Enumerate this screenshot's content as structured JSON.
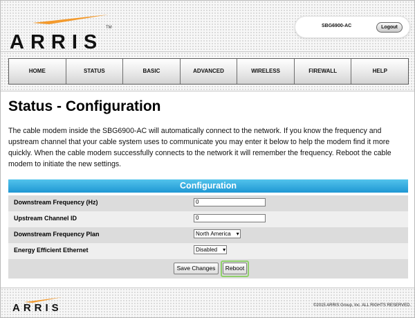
{
  "brand": {
    "logo_text": "ARRIS",
    "trademark": "TM",
    "swoosh_colors": [
      "#1b2d6b",
      "#f39a2d"
    ]
  },
  "header": {
    "model": "SBG6900-AC",
    "logout_label": "Logout"
  },
  "nav": {
    "tabs": [
      "HOME",
      "STATUS",
      "BASIC",
      "ADVANCED",
      "WIRELESS",
      "FIREWALL",
      "HELP"
    ]
  },
  "page": {
    "title": "Status - Configuration",
    "description": "The cable modem inside the SBG6900-AC will automatically connect to the network. If you know the frequency and upstream channel that your cable system uses to communicate you may enter it below to help the modem find it more quickly. When the cable modem successfully connects to the network it will remember the frequency. Reboot the cable modem to initiate the new settings."
  },
  "config": {
    "header": "Configuration",
    "header_color": "#2aa5dc",
    "rows": [
      {
        "label": "Downstream Frequency (Hz)",
        "value": "0"
      },
      {
        "label": "Upstream Channel ID",
        "value": "0"
      },
      {
        "label": "Downstream Frequency Plan",
        "value": "North America"
      },
      {
        "label": "Energy Efficient Ethernet",
        "value": "Disabled"
      }
    ],
    "row_colors": [
      "#dcdcdc",
      "#efefef"
    ],
    "save_label": "Save Changes",
    "reboot_label": "Reboot",
    "highlight_color": "#8fcf6a"
  },
  "footer": {
    "logo_text": "ARRIS",
    "copyright": "©2015 ARRIS Group, Inc. ALL RIGHTS RESERVED."
  },
  "icons": {
    "dropdown": "chevron-down-icon",
    "arrow_glyph": "▾"
  }
}
